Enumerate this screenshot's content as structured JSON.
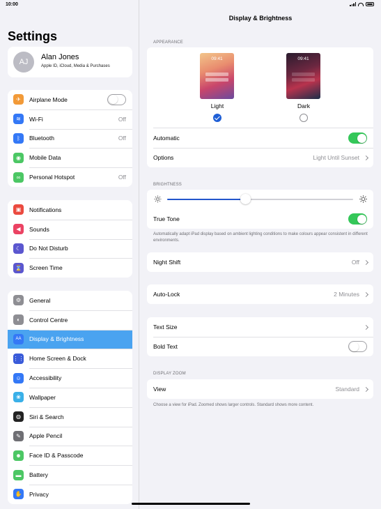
{
  "status": {
    "time": "10:00"
  },
  "sidebar": {
    "title": "Settings",
    "profile": {
      "initials": "AJ",
      "name": "Alan Jones",
      "subtitle": "Apple ID, iCloud, Media & Purchases"
    },
    "group1": [
      {
        "label": "Airplane Mode",
        "icon": "airplane-icon",
        "color": "#f29a38",
        "toggle": "off"
      },
      {
        "label": "Wi-Fi",
        "icon": "wifi-icon",
        "color": "#3478f6",
        "value": "Off"
      },
      {
        "label": "Bluetooth",
        "icon": "bluetooth-icon",
        "color": "#3478f6",
        "value": "Off"
      },
      {
        "label": "Mobile Data",
        "icon": "antenna-icon",
        "color": "#4cc764"
      },
      {
        "label": "Personal Hotspot",
        "icon": "link-icon",
        "color": "#4cc764",
        "value": "Off"
      }
    ],
    "group2": [
      {
        "label": "Notifications",
        "icon": "notifications-icon",
        "color": "#eb4a3f"
      },
      {
        "label": "Sounds",
        "icon": "speaker-icon",
        "color": "#eb4363"
      },
      {
        "label": "Do Not Disturb",
        "icon": "moon-icon",
        "color": "#5b57cf"
      },
      {
        "label": "Screen Time",
        "icon": "hourglass-icon",
        "color": "#5b57cf"
      }
    ],
    "group3": [
      {
        "label": "General",
        "icon": "gear-icon",
        "color": "#8e8e93"
      },
      {
        "label": "Control Centre",
        "icon": "switches-icon",
        "color": "#8e8e93"
      },
      {
        "label": "Display & Brightness",
        "icon": "text-size-icon",
        "color": "#3478f6",
        "selected": true
      },
      {
        "label": "Home Screen & Dock",
        "icon": "grid-icon",
        "color": "#3a5bd9"
      },
      {
        "label": "Accessibility",
        "icon": "accessibility-icon",
        "color": "#3478f6"
      },
      {
        "label": "Wallpaper",
        "icon": "flower-icon",
        "color": "#3ab0e8"
      },
      {
        "label": "Siri & Search",
        "icon": "siri-icon",
        "color": "#222222"
      },
      {
        "label": "Apple Pencil",
        "icon": "pencil-icon",
        "color": "#6f6f74"
      },
      {
        "label": "Face ID & Passcode",
        "icon": "face-id-icon",
        "color": "#4cc764"
      },
      {
        "label": "Battery",
        "icon": "battery-icon",
        "color": "#4cc764"
      },
      {
        "label": "Privacy",
        "icon": "hand-icon",
        "color": "#3478f6"
      }
    ]
  },
  "detail": {
    "title": "Display & Brightness",
    "appearance_header": "APPEARANCE",
    "light": {
      "time": "09:41",
      "label": "Light"
    },
    "dark": {
      "time": "09:41",
      "label": "Dark"
    },
    "automatic_label": "Automatic",
    "options_label": "Options",
    "options_value": "Light Until Sunset",
    "brightness_header": "BRIGHTNESS",
    "brightness_level": 0.42,
    "true_tone_label": "True Tone",
    "true_tone_note": "Automatically adapt iPad display based on ambient lighting conditions to make colours appear consistent in different environments.",
    "night_shift_label": "Night Shift",
    "night_shift_value": "Off",
    "auto_lock_label": "Auto-Lock",
    "auto_lock_value": "2 Minutes",
    "text_size_label": "Text Size",
    "bold_text_label": "Bold Text",
    "zoom_header": "DISPLAY ZOOM",
    "view_label": "View",
    "view_value": "Standard",
    "zoom_note": "Choose a view for iPad. Zoomed shows larger controls. Standard shows more content."
  }
}
